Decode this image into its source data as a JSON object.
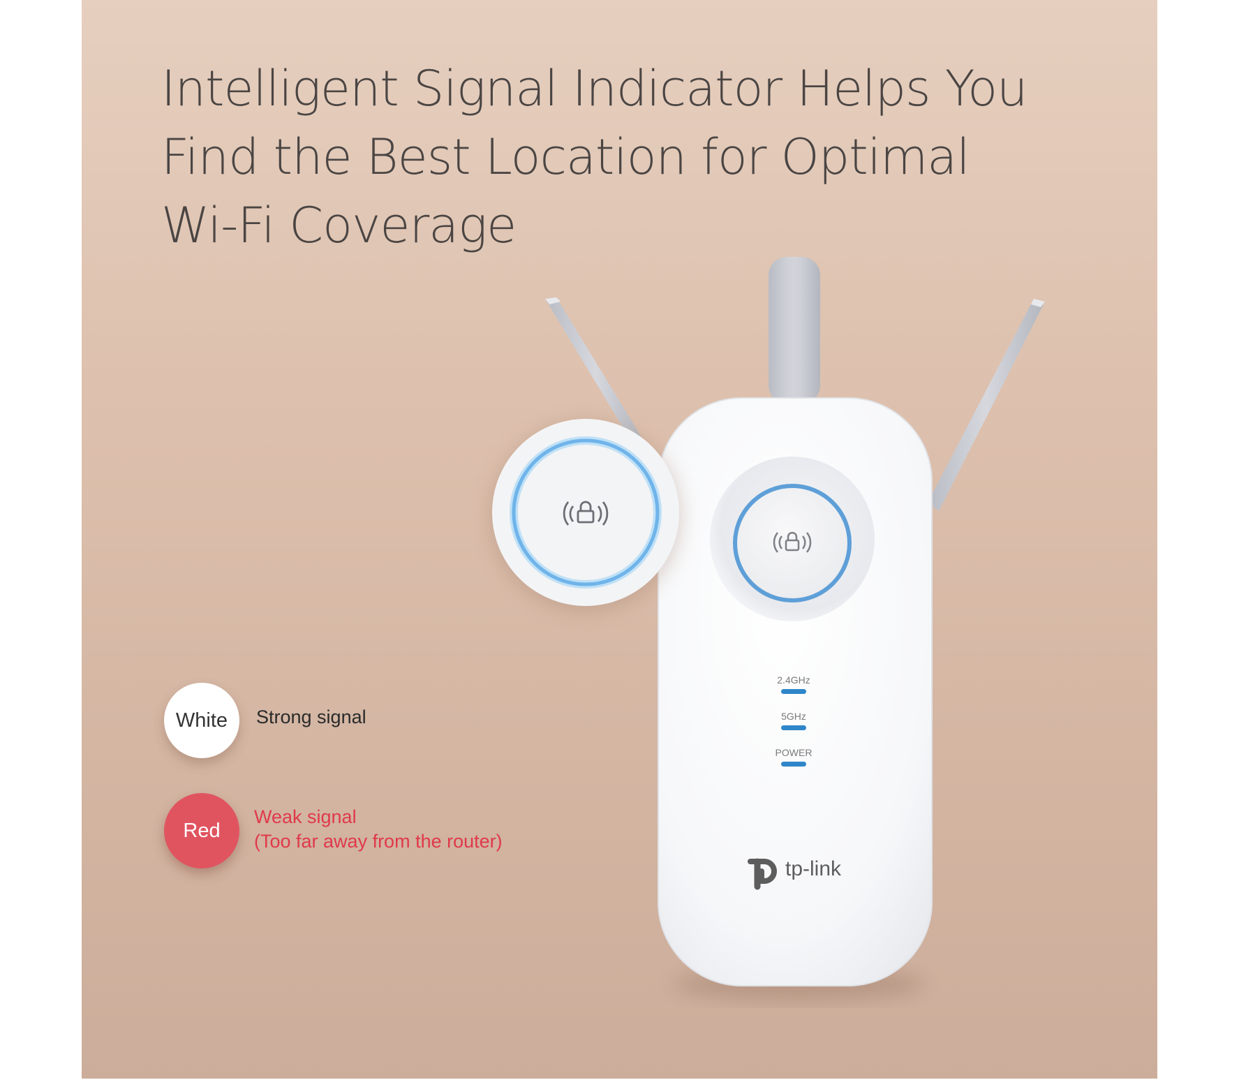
{
  "headline": {
    "line1": "Intelligent Signal Indicator Helps You",
    "line2": "Find the Best Location for Optimal",
    "line3": "Wi-Fi Coverage"
  },
  "legend": {
    "white": {
      "dot_label": "White",
      "description": "Strong signal",
      "color": "#ffffff"
    },
    "red": {
      "dot_label": "Red",
      "description_line1": "Weak signal",
      "description_line2": "(Too far away from the router)",
      "color": "#e05460"
    }
  },
  "device": {
    "led_labels": [
      "2.4GHz",
      "5GHz",
      "POWER"
    ],
    "brand": "tp-link",
    "ring_color": "#5aa6e0",
    "button_icon": "wifi-lock-icon",
    "zoom_icon": "wifi-lock-icon"
  },
  "colors": {
    "background": "#dcbfac",
    "headline_text": "#4a4543",
    "weak_text": "#e0394a",
    "led": "#2f86c9"
  }
}
